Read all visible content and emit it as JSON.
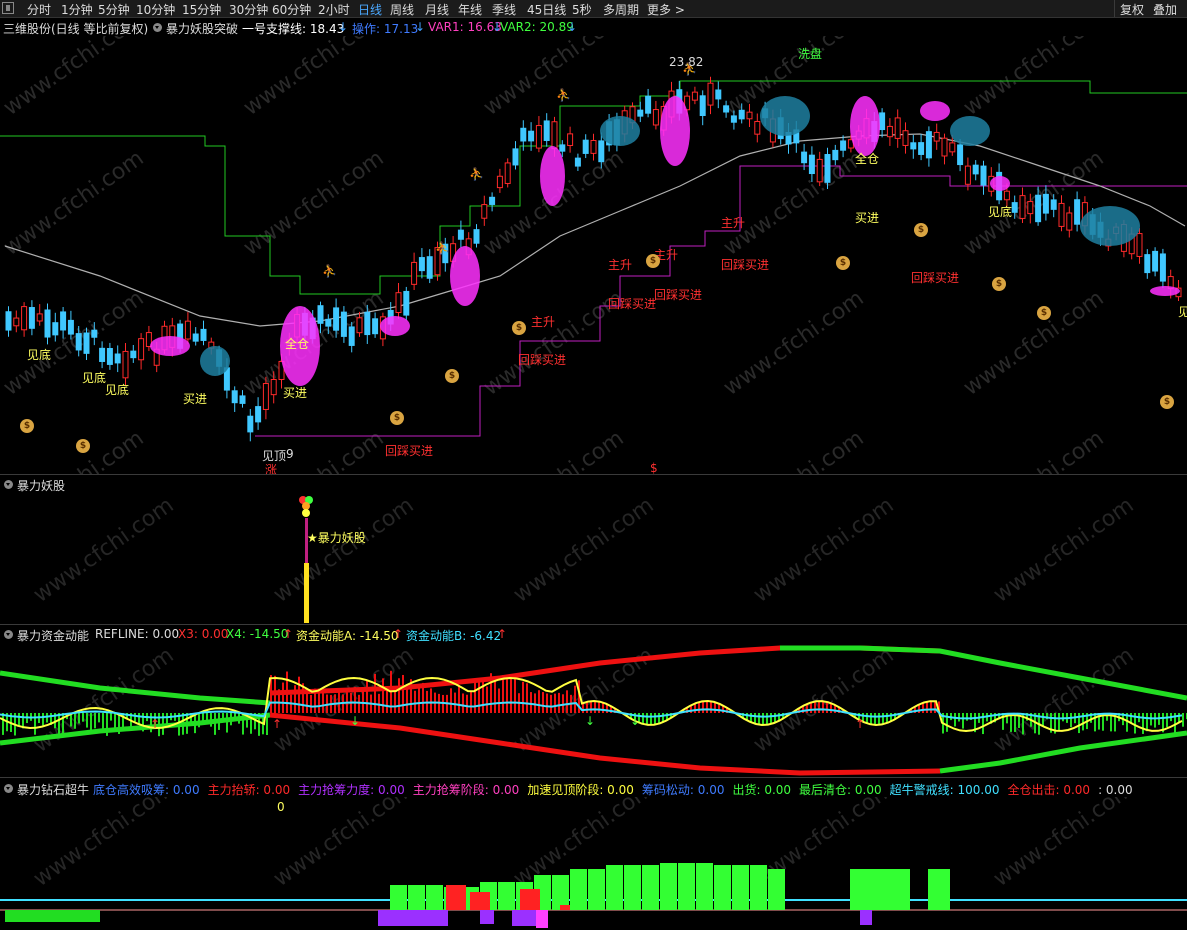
{
  "toolbar": {
    "periods": [
      "分时",
      "1分钟",
      "5分钟",
      "10分钟",
      "15分钟",
      "30分钟",
      "60分钟",
      "2小时",
      "日线",
      "周线",
      "月线",
      "年线",
      "季线",
      "45日线",
      "5秒",
      "多周期",
      "更多 >"
    ],
    "active_period": "日线",
    "right_buttons": [
      "复权",
      "叠加"
    ]
  },
  "main_header": {
    "title": "三维股份(日线 等比前复权)",
    "indicator": "暴力妖股突破",
    "support_label": "一号支撑线: 18.43",
    "operate_label": "操作: 17.13",
    "var1_label": "VAR1: 16.63",
    "var2_label": "VAR2: 20.89",
    "arrow_down": "↓"
  },
  "main_chart": {
    "high_price_label": "23.82",
    "low_price_label": "9",
    "signals": {
      "jiandi": "见底",
      "maijin": "买进",
      "zhusheng": "主升",
      "huicai": "回踩买进",
      "quancang": "全仓",
      "xipan": "洗盘",
      "zhang": "涨",
      "dollar": "$",
      "jianding": "见顶",
      "bag_glyph": "$",
      "runner_glyph": "⛹"
    }
  },
  "panel2": {
    "title": "暴力妖股",
    "marker_label": "★暴力妖股"
  },
  "panel3": {
    "title": "暴力资金动能",
    "refline": "REFLINE: 0.00",
    "x3": "X3: 0.00",
    "x4": "X4: -14.50",
    "zjdna": "资金动能A: -14.50",
    "zjdnb": "资金动能B: -6.42",
    "up_arrow": "↑"
  },
  "panel4": {
    "title": "暴力钻石超牛",
    "items": [
      {
        "text": "底仓高效吸筹: 0.00",
        "color": "#3f7bff"
      },
      {
        "text": "主力抬轿: 0.00",
        "color": "#ff2a2a"
      },
      {
        "text": "主力抢筹力度: 0.00",
        "color": "#b030ff"
      },
      {
        "text": "主力抢筹阶段: 0.00",
        "color": "#ff40c0"
      },
      {
        "text": "加速见顶阶段: 0.00",
        "color": "#ffff40"
      },
      {
        "text": "筹码松动: 0.00",
        "color": "#3f7bff"
      },
      {
        "text": "出货: 0.00",
        "color": "#40ff40"
      },
      {
        "text": "最后清仓: 0.00",
        "color": "#40ff40"
      },
      {
        "text": "超牛警戒线: 100.00",
        "color": "#40e0ff"
      },
      {
        "text": "全仓出击: 0.00",
        "color": "#ff2a2a"
      },
      {
        "text": ": 0.00",
        "color": "#dddddd"
      }
    ],
    "zero_label": "0"
  },
  "watermark": "www.cfchi.com"
}
